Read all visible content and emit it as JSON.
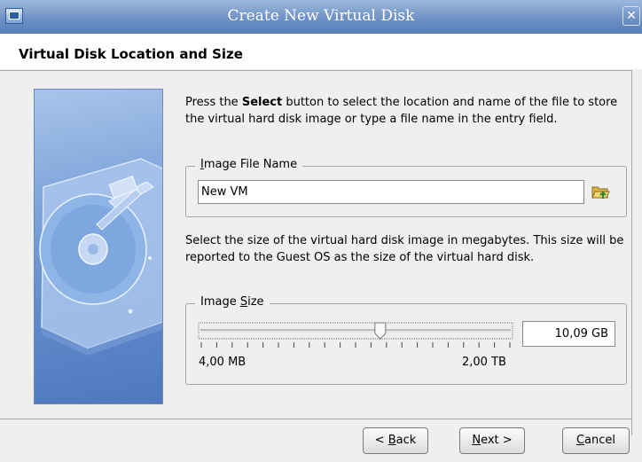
{
  "window": {
    "title": "Create New Virtual Disk",
    "close_glyph": "✕"
  },
  "page_title": "Virtual Disk Location and Size",
  "intro": {
    "before": "Press the ",
    "bold": "Select",
    "after": " button to select the location and name of the file to store the virtual hard disk image or type a file name in the entry field."
  },
  "image_file": {
    "legend_mnemonic": "I",
    "legend_rest": "mage File Name",
    "value": "New VM",
    "select_icon": "folder-open-icon"
  },
  "size_desc": "Select the size of the virtual hard disk image in megabytes. This size will be reported to the Guest OS as the size of the virtual hard disk.",
  "image_size": {
    "legend_before": "Image ",
    "legend_mnemonic": "S",
    "legend_rest": "ize",
    "value": "10,09 GB",
    "min_label": "4,00 MB",
    "max_label": "2,00 TB",
    "slider_fraction": 0.58
  },
  "buttons": {
    "back": {
      "prefix": "< ",
      "mnemonic": "B",
      "rest": "ack"
    },
    "next": {
      "mnemonic": "N",
      "rest": "ext >"
    },
    "cancel": {
      "mnemonic": "C",
      "rest": "ancel"
    }
  },
  "colors": {
    "titlebar": "#6b8fc3",
    "art_blue": "#5e88c9"
  }
}
